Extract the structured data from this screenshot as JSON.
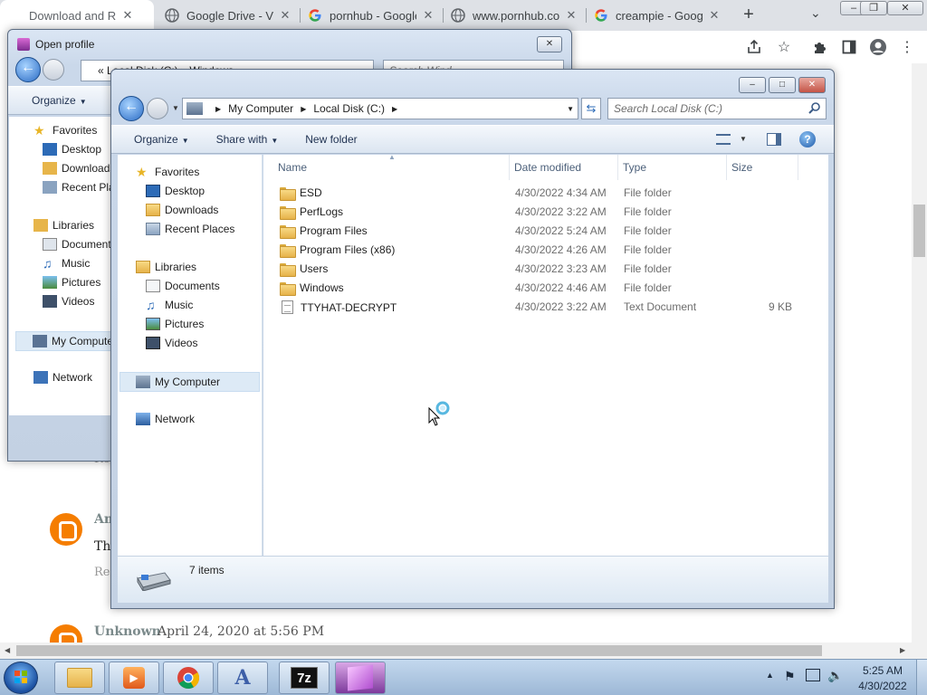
{
  "browser": {
    "tabs": [
      {
        "title": "Download and Re",
        "active": true
      },
      {
        "title": "Google Drive - Vi",
        "active": false
      },
      {
        "title": "pornhub - Google",
        "active": false
      },
      {
        "title": "www.pornhub.com",
        "active": false
      },
      {
        "title": "creampie - Google",
        "active": false
      }
    ],
    "new_tab": "+",
    "tab_menu": "⌄",
    "close_glyph": "✕"
  },
  "page": {
    "comments": [
      {
        "author": "An",
        "text": "Th",
        "reply": "Re"
      },
      {
        "author": "Unknown",
        "date": "April 24, 2020 at 5:56 PM"
      }
    ],
    "reply_top": "Re"
  },
  "open_profile": {
    "title": "Open profile",
    "address": "« Local Disk (C:) ▸ Windows ▸",
    "search_placeholder": "Search Wind...",
    "organize": "Organize",
    "nav": [
      {
        "label": "Favorites",
        "icon": "star-icon"
      },
      {
        "label": "Desktop",
        "icon": "desktop-icon"
      },
      {
        "label": "Downloads",
        "icon": "downloads-icon"
      },
      {
        "label": "Recent Places",
        "icon": "recent-places-icon"
      },
      {
        "label": "Libraries",
        "icon": "libraries-icon"
      },
      {
        "label": "Documents",
        "icon": "documents-icon"
      },
      {
        "label": "Music",
        "icon": "music-icon"
      },
      {
        "label": "Pictures",
        "icon": "pictures-icon"
      },
      {
        "label": "Videos",
        "icon": "videos-icon"
      },
      {
        "label": "My Computer",
        "icon": "computer-icon"
      },
      {
        "label": "Network",
        "icon": "network-icon"
      }
    ]
  },
  "explorer": {
    "address": {
      "crumbs": [
        "My Computer",
        "Local Disk (C:)"
      ]
    },
    "search_placeholder": "Search Local Disk (C:)",
    "commands": {
      "organize": "Organize",
      "share_with": "Share with",
      "new_folder": "New folder"
    },
    "nav": {
      "favorites": "Favorites",
      "desktop": "Desktop",
      "downloads": "Downloads",
      "recent": "Recent Places",
      "libraries": "Libraries",
      "documents": "Documents",
      "music": "Music",
      "pictures": "Pictures",
      "videos": "Videos",
      "my_computer": "My Computer",
      "network": "Network"
    },
    "columns": {
      "name": "Name",
      "date": "Date modified",
      "type": "Type",
      "size": "Size"
    },
    "files": [
      {
        "name": "ESD",
        "date": "4/30/2022 4:34 AM",
        "type": "File folder",
        "size": "",
        "kind": "folder"
      },
      {
        "name": "PerfLogs",
        "date": "4/30/2022 3:22 AM",
        "type": "File folder",
        "size": "",
        "kind": "folder"
      },
      {
        "name": "Program Files",
        "date": "4/30/2022 5:24 AM",
        "type": "File folder",
        "size": "",
        "kind": "folder"
      },
      {
        "name": "Program Files (x86)",
        "date": "4/30/2022 4:26 AM",
        "type": "File folder",
        "size": "",
        "kind": "folder"
      },
      {
        "name": "Users",
        "date": "4/30/2022 3:23 AM",
        "type": "File folder",
        "size": "",
        "kind": "folder"
      },
      {
        "name": "Windows",
        "date": "4/30/2022 4:46 AM",
        "type": "File folder",
        "size": "",
        "kind": "folder"
      },
      {
        "name": "TTYHAT-DECRYPT",
        "date": "4/30/2022 3:22 AM",
        "type": "Text Document",
        "size": "9 KB",
        "kind": "document"
      }
    ],
    "status": "7 items"
  },
  "taskbar": {
    "apps": [
      "file-explorer-icon",
      "media-player-icon",
      "chrome-icon",
      "app-a-icon",
      "7zip-icon",
      "windows-app-icon"
    ],
    "app_7z": "7z",
    "time": "5:25 AM",
    "date": "4/30/2022"
  },
  "colors": {
    "accent": "#2a6bc4",
    "taskbar": "#9db8d6",
    "folder": "#f8da86"
  }
}
